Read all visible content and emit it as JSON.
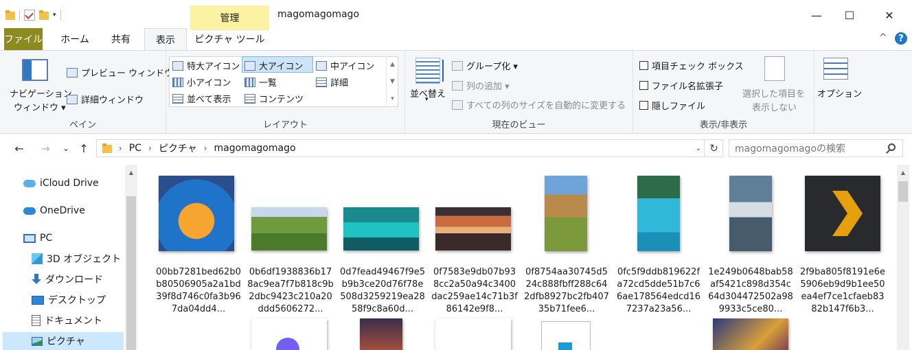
{
  "window": {
    "title": "magomagomago",
    "context_tab_header": "管理",
    "minimize": "—",
    "maximize": "☐",
    "close": "✕"
  },
  "ribbon_tabs": [
    "ファイル",
    "ホーム",
    "共有",
    "表示",
    "ピクチャ ツール"
  ],
  "ribbon_collapse": "^",
  "help": "?",
  "panes_group": {
    "label": "ペイン",
    "nav_pane_line1": "ナビゲーション",
    "nav_pane_line2": "ウィンドウ ▾",
    "preview": "プレビュー ウィンドウ",
    "details": "詳細ウィンドウ"
  },
  "layout_group": {
    "label": "レイアウト",
    "items": [
      "特大アイコン",
      "大アイコン",
      "中アイコン",
      "小アイコン",
      "一覧",
      "詳細",
      "並べて表示",
      "コンテンツ"
    ]
  },
  "current_view_group": {
    "label": "現在のビュー",
    "sort_line1": "並べ替え",
    "sort_line2": "▾",
    "group_by": "グループ化 ▾",
    "add_column": "列の追加 ▾",
    "fit_columns": "すべての列のサイズを自動的に変更する"
  },
  "show_hide_group": {
    "label": "表示/非表示",
    "item_checkboxes": "項目チェック ボックス",
    "file_extensions": "ファイル名拡張子",
    "hidden_items": "隠しファイル",
    "hide_selected_line1": "選択した項目を",
    "hide_selected_line2": "表示しない"
  },
  "options": "オプション",
  "address": {
    "back": "←",
    "forward": "→",
    "recent": "⌄",
    "up": "↑",
    "crumbs": [
      "PC",
      "ピクチャ",
      "magomagomago"
    ],
    "separator": "›",
    "dropdown": "⌄",
    "refresh": "↻"
  },
  "search": {
    "placeholder": "magomagomagoの検索"
  },
  "nav_pane": {
    "items": [
      "iCloud Drive",
      "OneDrive",
      "PC",
      "3D オブジェクト",
      "ダウンロード",
      "デスクトップ",
      "ドキュメント",
      "ピクチャ"
    ]
  },
  "files": [
    "00bb7281bed62b0b80506905a2a1bd39f8d746c0fa3b967da04dd4...",
    "0b6df1938836b178ac9ea7f7b818c9b2dbc9423c210a20ddd5606272...",
    "0d7fead49467f9e5b9b3ce20d76f78e508d3259219ea2858f9c8a60d...",
    "0f7583e9db07b938cc2a50a94c3400dac259ae14c71b3f86142e9f8...",
    "0f8754aa30745d524c888fbff288c642dfb8927bc2fb40735b71fee6...",
    "0fc5f9ddb819622fa72cd5dde51b7c66ae178564edcd167237a23a56...",
    "1e249b0648bab58af5421c898d354c64d304472502a989933c5ce80...",
    "2f9ba805f8191e6e5906eb9d9b1ee50ea4ef7ce1cfaeb8382b147f6b3..."
  ],
  "scroll_arrow_up": "▲"
}
